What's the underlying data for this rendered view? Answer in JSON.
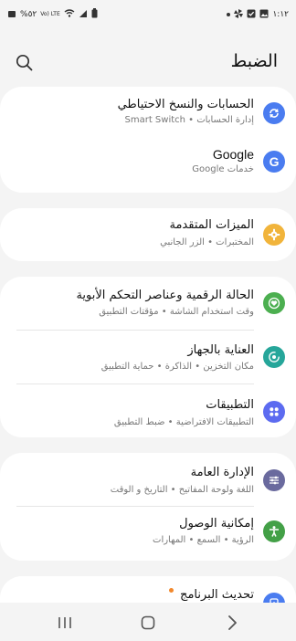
{
  "status_bar": {
    "battery_percent": "%٥٢",
    "network": "Vo) LTE",
    "time": "١:١٢"
  },
  "header": {
    "title": "الضبط"
  },
  "cards": [
    {
      "items": [
        {
          "title": "الحسابات والنسخ الاحتياطي",
          "subtitle": "إدارة الحسابات  •  Smart Switch",
          "icon": "sync-icon",
          "color": "#4a7cf0"
        },
        {
          "title": "Google",
          "subtitle": "خدمات Google",
          "icon": "google-icon",
          "color": "#4a7cf0"
        }
      ]
    },
    {
      "items": [
        {
          "title": "الميزات المتقدمة",
          "subtitle": "المختبرات  •  الزر الجانبي",
          "icon": "gear-icon",
          "color": "#f1b43b"
        }
      ]
    },
    {
      "items": [
        {
          "title": "الحالة الرقمية وعناصر التحكم الأبوية",
          "subtitle": "وقت استخدام الشاشة  •  مؤقتات التطبيق",
          "icon": "heart-icon",
          "color": "#4caf50"
        },
        {
          "title": "العناية بالجهاز",
          "subtitle": "مكان التخزين  •  الذاكرة  •  حماية التطبيق",
          "icon": "device-care-icon",
          "color": "#26a69a"
        },
        {
          "title": "التطبيقات",
          "subtitle": "التطبيقات الافتراضية  •  ضبط التطبيق",
          "icon": "apps-icon",
          "color": "#5c6bf0"
        }
      ]
    },
    {
      "items": [
        {
          "title": "الإدارة العامة",
          "subtitle": "اللغة ولوحة المفاتيح  •  التاريخ و الوقت",
          "icon": "sliders-icon",
          "color": "#6a6a9e"
        },
        {
          "title": "إمكانية الوصول",
          "subtitle": "الرؤية  •  السمع  •  المهارات",
          "icon": "accessibility-icon",
          "color": "#43a047"
        }
      ]
    },
    {
      "items": [
        {
          "title": "تحديث البرنامج",
          "subtitle": "",
          "icon": "update-icon",
          "color": "#4a7cf0"
        }
      ]
    }
  ],
  "nav": {
    "recents": "recents-icon",
    "home": "home-icon",
    "back": "back-icon"
  }
}
